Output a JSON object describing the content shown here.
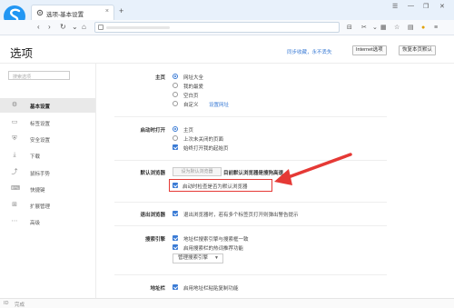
{
  "browser": {
    "tab_title": "选项-基本设置",
    "tab_close": "×",
    "new_tab": "+",
    "window_controls": [
      "☰",
      "—",
      "❐",
      "✕"
    ]
  },
  "header": {
    "title": "选项",
    "sync_link": "同步收藏，永不丢失",
    "internet_options": "Internet选项",
    "restore_defaults": "恢复本页默认"
  },
  "sidebar": {
    "search_placeholder": "搜索选项",
    "items": [
      {
        "label": "基本设置",
        "icon": "gear-icon",
        "glyph": "⚙"
      },
      {
        "label": "标签设置",
        "icon": "tab-icon",
        "glyph": "▭"
      },
      {
        "label": "安全设置",
        "icon": "shield-icon",
        "glyph": "⛨"
      },
      {
        "label": "下载",
        "icon": "download-icon",
        "glyph": "⤓"
      },
      {
        "label": "鼠标手势",
        "icon": "mouse-gesture-icon",
        "glyph": "⤴"
      },
      {
        "label": "快捷键",
        "icon": "keyboard-icon",
        "glyph": "⌨"
      },
      {
        "label": "扩展管理",
        "icon": "extension-icon",
        "glyph": "⊞"
      },
      {
        "label": "高级",
        "icon": "more-icon",
        "glyph": "⋯"
      }
    ]
  },
  "sections": {
    "homepage": {
      "title": "主页",
      "options": [
        "网址大全",
        "我的最爱",
        "空白页",
        "自定义"
      ],
      "set_url": "设置网址"
    },
    "startup": {
      "title": "启动时打开",
      "options": [
        "主页",
        "上次未关闭的页面"
      ],
      "check": "始终打开我的起始页"
    },
    "default_browser": {
      "title": "默认浏览器",
      "button": "设为默认浏览器",
      "note": "目前默认浏览器是搜狗高速",
      "check": "启动时检查是否为默认浏览器"
    },
    "exit": {
      "title": "退出浏览器",
      "check": "退出浏览器时，若有多个标签页打开则弹出警告提示"
    },
    "search_engine": {
      "title": "搜索引擎",
      "checks": [
        "地址栏搜索引擎与搜索框一致",
        "启用搜索栏的热词推荐功能"
      ],
      "dropdown": "管理搜索引擎"
    },
    "address_bar": {
      "title": "地址栏",
      "check": "启用地址栏粘贴复制功能"
    }
  },
  "status": {
    "left": "ID",
    "text": "完成"
  },
  "colors": {
    "accent": "#3a7bd5",
    "highlight": "#e53935",
    "logo": "#2196f3"
  }
}
